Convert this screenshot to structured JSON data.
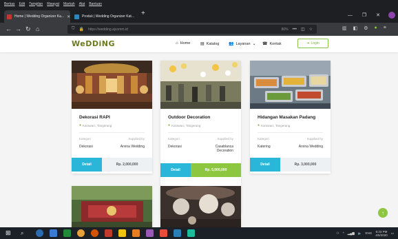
{
  "browser": {
    "menu": [
      "Berkas",
      "Edit",
      "Tampilan",
      "Riwayat",
      "Markah",
      "Alat",
      "Bantuan"
    ],
    "tabs": [
      {
        "title": "Home | Wedding Organizer Ka..."
      },
      {
        "title": "Produk | Wedding Organizer Kat..."
      }
    ],
    "new_tab": "+",
    "url": "https://wedding.ajcomm.id",
    "zoom": "80%"
  },
  "site": {
    "logo": "WeDDiNG",
    "nav": [
      {
        "icon": "home-icon",
        "label": "Home"
      },
      {
        "icon": "catalog-icon",
        "label": "Katalog"
      },
      {
        "icon": "services-icon",
        "label": "Layanan"
      },
      {
        "icon": "contact-icon",
        "label": "Kontak"
      }
    ],
    "login_label": "Login",
    "cards": [
      {
        "title": "Dekorasi RAPI",
        "location": "Karawaci, Tangerang",
        "kategori_label": "Kategori",
        "supplied_label": "Supplied by",
        "kategori": "Dekorasi",
        "supplier": "Arvina Wedding",
        "detail_label": "Detail",
        "price": "Rp. 2,000,000"
      },
      {
        "title": "Outdoor Decoration",
        "location": "Karawaci, Tangerang",
        "kategori_label": "Kategori",
        "supplied_label": "Supplied by",
        "kategori": "Dekorasi",
        "supplier_line1": "Casablanca",
        "supplier_line2": "Decoration",
        "detail_label": "Detail",
        "price": "Rp. 5,000,000"
      },
      {
        "title": "Hidangan Masakan Padang",
        "location": "Karawaci, Tangerang",
        "kategori_label": "Kategori",
        "supplied_label": "Supplied by",
        "kategori": "Katering",
        "supplier": "Arvina Wedding",
        "detail_label": "Detail",
        "price": "Rp. 3,000,000"
      }
    ]
  },
  "taskbar": {
    "lang": "ENG",
    "time": "6:23 PM",
    "date": "4/5/2020"
  },
  "colors": {
    "accent_blue": "#29b6d9",
    "accent_green": "#8dc63f",
    "logo": "#6b7b1e"
  }
}
